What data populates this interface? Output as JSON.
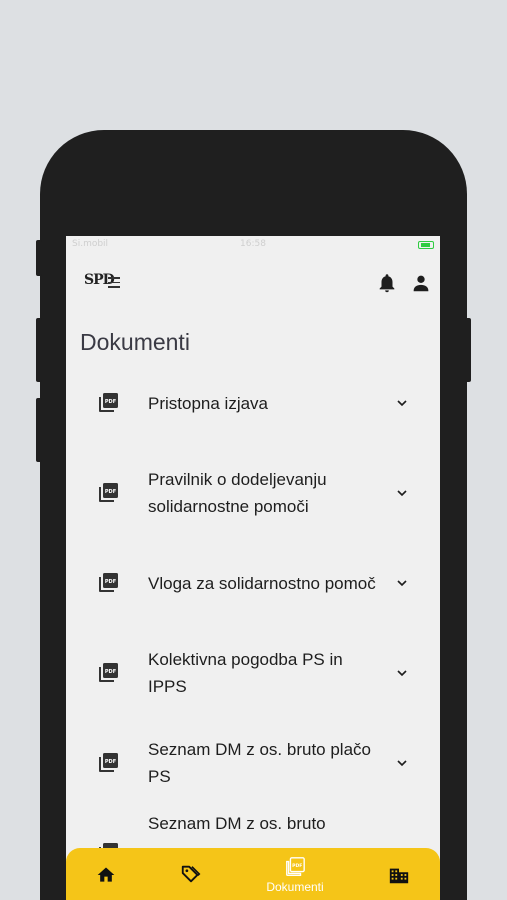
{
  "status_bar": {
    "carrier": "Si.mobil",
    "time": "16:58"
  },
  "app_bar": {
    "logo_text": "SPD"
  },
  "page": {
    "title": "Dokumenti"
  },
  "documents": [
    {
      "label": "Pristopna izjava"
    },
    {
      "label": "Pravilnik o dodeljevanju solidarnostne pomoči"
    },
    {
      "label": "Vloga za solidarnostno pomoč"
    },
    {
      "label": "Kolektivna pogodba PS in IPPS"
    },
    {
      "label": "Seznam DM z os. bruto plačo PS"
    },
    {
      "label": "Seznam DM z os. bruto"
    }
  ],
  "bottom_nav": {
    "items": [
      {
        "name": "home-icon",
        "label": ""
      },
      {
        "name": "tag-icon",
        "label": ""
      },
      {
        "name": "documents-icon",
        "label": "Dokumenti",
        "active": true
      },
      {
        "name": "building-icon",
        "label": ""
      }
    ]
  },
  "colors": {
    "accent": "#f5c518",
    "background": "#f0f0f0",
    "frame": "#1f1f1f"
  }
}
